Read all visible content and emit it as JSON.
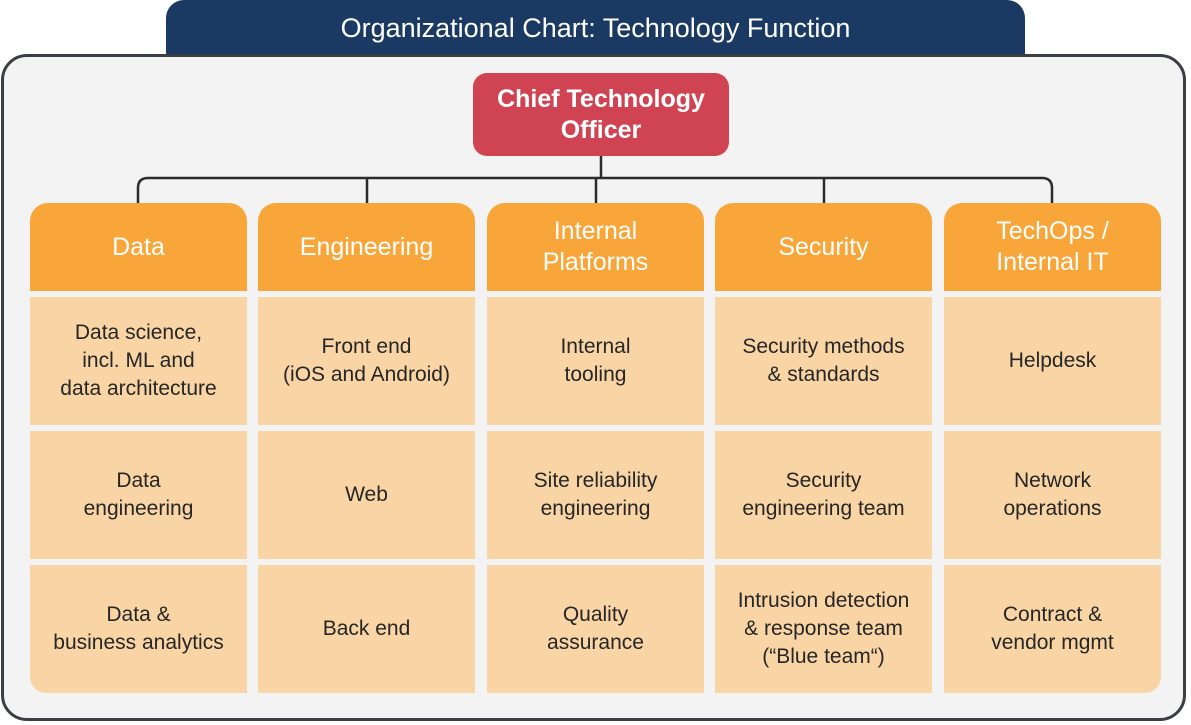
{
  "title": "Organizational Chart: Technology Function",
  "root": {
    "label": "Chief Technology Officer"
  },
  "departments": [
    {
      "name": "Data",
      "teams": [
        "Data science,\nincl. ML and\ndata architecture",
        "Data\nengineering",
        "Data &\nbusiness analytics"
      ]
    },
    {
      "name": "Engineering",
      "teams": [
        "Front end\n(iOS and Android)",
        "Web",
        "Back end"
      ]
    },
    {
      "name": "Internal Platforms",
      "teams": [
        "Internal\ntooling",
        "Site reliability\nengineering",
        "Quality\nassurance"
      ]
    },
    {
      "name": "Security",
      "teams": [
        "Security methods\n& standards",
        "Security\nengineering team",
        "Intrusion detection\n& response team\n(“Blue team“)"
      ]
    },
    {
      "name": "TechOps /\nInternal IT",
      "teams": [
        "Helpdesk",
        "Network\noperations",
        "Contract &\nvendor mgmt"
      ]
    }
  ],
  "colors": {
    "title_bg": "#1b3a63",
    "root_bg": "#cf4352",
    "dept_bg": "#f8a53a",
    "team_bg": "#f9d5a5",
    "panel_bg": "#f3f3f3"
  }
}
